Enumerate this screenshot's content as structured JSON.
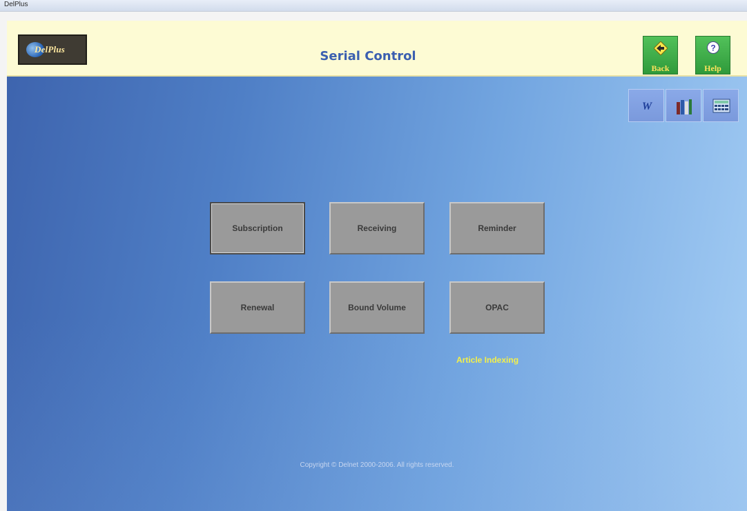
{
  "window": {
    "title": "DelPlus"
  },
  "header": {
    "logo_text": "DelPlus",
    "title": "Serial Control",
    "back_label": "Back",
    "help_label": "Help",
    "accent_color": "#3b5fb0",
    "button_color": "#2f9a3b",
    "button_label_color": "#ffe35c"
  },
  "toolbar": {
    "tools": [
      {
        "icon": "word-icon",
        "glyph": "W"
      },
      {
        "icon": "books-icon"
      },
      {
        "icon": "calculator-icon"
      }
    ]
  },
  "menu": {
    "buttons": [
      {
        "label": "Subscription",
        "focused": true
      },
      {
        "label": "Receiving"
      },
      {
        "label": "Reminder"
      },
      {
        "label": "Renewal"
      },
      {
        "label": "Bound Volume"
      },
      {
        "label": "OPAC"
      }
    ]
  },
  "links": {
    "article_indexing": "Article Indexing",
    "link_color": "#f4f04a"
  },
  "footer": {
    "copyright": "Copyright © Delnet 2000-2006. All rights reserved."
  }
}
